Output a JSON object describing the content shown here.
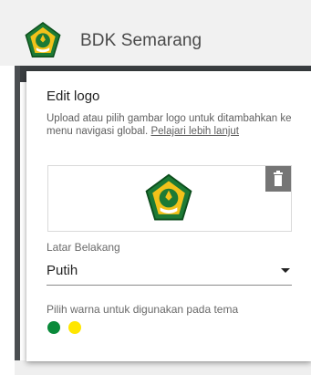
{
  "header": {
    "site_title": "BDK Semarang",
    "logo_icon": "kemenag-emblem-icon"
  },
  "dialog": {
    "title": "Edit logo",
    "description": "Upload atau pilih gambar logo untuk ditambahkan ke menu navigasi global.",
    "learn_more": "Pelajari lebih lanjut",
    "logo_preview_icon": "kemenag-emblem-icon",
    "delete_icon": "trash-icon",
    "background_label": "Latar Belakang",
    "background_value": "Putih",
    "theme_color_label": "Pilih warna untuk digunakan pada tema",
    "theme_colors": [
      "#0a8a3a",
      "#ffe600"
    ]
  }
}
